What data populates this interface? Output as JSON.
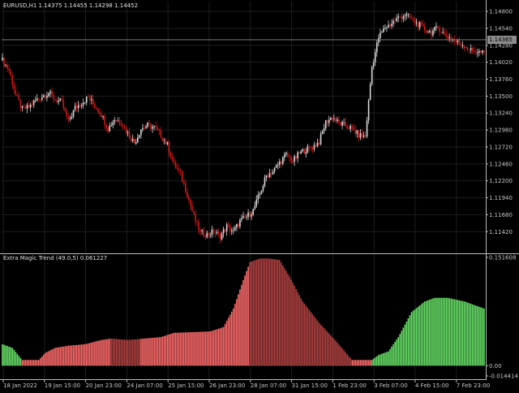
{
  "main_header": {
    "symbol": "EURUSD,H1",
    "open": "1.14375",
    "high": "1.14455",
    "low": "1.14298",
    "close": "1.14452"
  },
  "current_price_label": "1.14365",
  "indicator_header": {
    "name": "Extra Magic Trend (49.0,5)",
    "value": "0.061227"
  },
  "colors": {
    "background": "#000000",
    "grid": "#1e1e1e",
    "candle_bull": "#d8d8d8",
    "candle_bear": "#d01818",
    "hist_red": "#ff6a6a",
    "hist_dark_red": "#b04040",
    "hist_green": "#66e066",
    "text": "#c8c8c8"
  },
  "chart_data": [
    {
      "type": "candlestick",
      "title": "EURUSD,H1",
      "ylim": [
        1.111,
        1.1495
      ],
      "y_ticks": [
        "1.14800",
        "1.14540",
        "1.14280",
        "1.14020",
        "1.13760",
        "1.13500",
        "1.13240",
        "1.12980",
        "1.12720",
        "1.12460",
        "1.12200",
        "1.11940",
        "1.11680",
        "1.11420"
      ],
      "y_tick_values": [
        1.148,
        1.1454,
        1.1428,
        1.1402,
        1.1376,
        1.135,
        1.1324,
        1.1298,
        1.1272,
        1.1246,
        1.122,
        1.1194,
        1.1168,
        1.1142
      ],
      "current_price": 1.14365,
      "x_ticks": [
        "18 Jan 2022",
        "19 Jan 15:00",
        "20 Jan 23:00",
        "24 Jan 07:00",
        "25 Jan 15:00",
        "26 Jan 23:00",
        "28 Jan 07:00",
        "31 Jan 15:00",
        "1 Feb 23:00",
        "3 Feb 07:00",
        "4 Feb 15:00",
        "7 Feb 23:00"
      ],
      "close_path": [
        [
          0,
          1.1405
        ],
        [
          4,
          1.139
        ],
        [
          8,
          1.1352
        ],
        [
          12,
          1.133
        ],
        [
          16,
          1.1333
        ],
        [
          20,
          1.1343
        ],
        [
          24,
          1.135
        ],
        [
          28,
          1.1355
        ],
        [
          32,
          1.1345
        ],
        [
          36,
          1.134
        ],
        [
          40,
          1.131
        ],
        [
          44,
          1.1332
        ],
        [
          48,
          1.134
        ],
        [
          52,
          1.1348
        ],
        [
          56,
          1.1335
        ],
        [
          60,
          1.1322
        ],
        [
          64,
          1.13
        ],
        [
          68,
          1.1315
        ],
        [
          72,
          1.131
        ],
        [
          76,
          1.1293
        ],
        [
          80,
          1.1278
        ],
        [
          84,
          1.13
        ],
        [
          88,
          1.1305
        ],
        [
          92,
          1.1302
        ],
        [
          96,
          1.129
        ],
        [
          100,
          1.1275
        ],
        [
          104,
          1.1245
        ],
        [
          108,
          1.123
        ],
        [
          112,
          1.12
        ],
        [
          116,
          1.1165
        ],
        [
          120,
          1.114
        ],
        [
          124,
          1.1138
        ],
        [
          128,
          1.1142
        ],
        [
          132,
          1.1135
        ],
        [
          136,
          1.115
        ],
        [
          140,
          1.1142
        ],
        [
          144,
          1.1158
        ],
        [
          148,
          1.1165
        ],
        [
          152,
          1.1175
        ],
        [
          156,
          1.12
        ],
        [
          160,
          1.1228
        ],
        [
          164,
          1.1235
        ],
        [
          168,
          1.1248
        ],
        [
          172,
          1.126
        ],
        [
          176,
          1.125
        ],
        [
          180,
          1.1262
        ],
        [
          184,
          1.1268
        ],
        [
          188,
          1.1272
        ],
        [
          192,
          1.128
        ],
        [
          196,
          1.131
        ],
        [
          200,
          1.1318
        ],
        [
          204,
          1.1308
        ],
        [
          208,
          1.1305
        ],
        [
          212,
          1.13
        ],
        [
          216,
          1.129
        ],
        [
          220,
          1.1288
        ],
        [
          224,
          1.1395
        ],
        [
          228,
          1.144
        ],
        [
          232,
          1.1455
        ],
        [
          236,
          1.1462
        ],
        [
          240,
          1.147
        ],
        [
          244,
          1.1475
        ],
        [
          248,
          1.1468
        ],
        [
          252,
          1.146
        ],
        [
          256,
          1.1452
        ],
        [
          260,
          1.1448
        ],
        [
          264,
          1.1455
        ],
        [
          268,
          1.1445
        ],
        [
          272,
          1.1438
        ],
        [
          276,
          1.1432
        ],
        [
          280,
          1.1428
        ],
        [
          284,
          1.142
        ],
        [
          288,
          1.1418
        ],
        [
          292,
          1.1415
        ]
      ],
      "n_bars": 293
    },
    {
      "type": "histogram",
      "title": "Extra Magic Trend (49.0,5)",
      "ylim": [
        -0.014414,
        0.151608
      ],
      "y_ticks": [
        "0.151608",
        "0.00",
        "-0.014414"
      ],
      "y_tick_values": [
        0.151608,
        0.0,
        -0.014414
      ],
      "value_path": [
        [
          0,
          0.03
        ],
        [
          6,
          0.025
        ],
        [
          12,
          0.008
        ],
        [
          18,
          0.008
        ],
        [
          22,
          0.008
        ],
        [
          26,
          0.018
        ],
        [
          32,
          0.025
        ],
        [
          40,
          0.028
        ],
        [
          50,
          0.03
        ],
        [
          60,
          0.036
        ],
        [
          66,
          0.038
        ],
        [
          76,
          0.036
        ],
        [
          86,
          0.038
        ],
        [
          96,
          0.04
        ],
        [
          104,
          0.046
        ],
        [
          116,
          0.047
        ],
        [
          126,
          0.048
        ],
        [
          134,
          0.054
        ],
        [
          140,
          0.08
        ],
        [
          146,
          0.12
        ],
        [
          150,
          0.145
        ],
        [
          156,
          0.15
        ],
        [
          162,
          0.15
        ],
        [
          168,
          0.148
        ],
        [
          174,
          0.125
        ],
        [
          182,
          0.09
        ],
        [
          192,
          0.06
        ],
        [
          202,
          0.035
        ],
        [
          212,
          0.008
        ],
        [
          218,
          0.008
        ],
        [
          224,
          0.008
        ],
        [
          228,
          0.015
        ],
        [
          234,
          0.02
        ],
        [
          240,
          0.04
        ],
        [
          248,
          0.075
        ],
        [
          256,
          0.09
        ],
        [
          262,
          0.095
        ],
        [
          270,
          0.095
        ],
        [
          280,
          0.09
        ],
        [
          292,
          0.08
        ]
      ],
      "segments": [
        {
          "from": 0,
          "to": 12,
          "color": "green"
        },
        {
          "from": 12,
          "to": 22,
          "color": "red"
        },
        {
          "from": 22,
          "to": 66,
          "color": "red"
        },
        {
          "from": 66,
          "to": 84,
          "color": "dark_red"
        },
        {
          "from": 84,
          "to": 150,
          "color": "red"
        },
        {
          "from": 150,
          "to": 212,
          "color": "dark_red"
        },
        {
          "from": 212,
          "to": 224,
          "color": "red"
        },
        {
          "from": 224,
          "to": 293,
          "color": "green"
        }
      ]
    }
  ]
}
